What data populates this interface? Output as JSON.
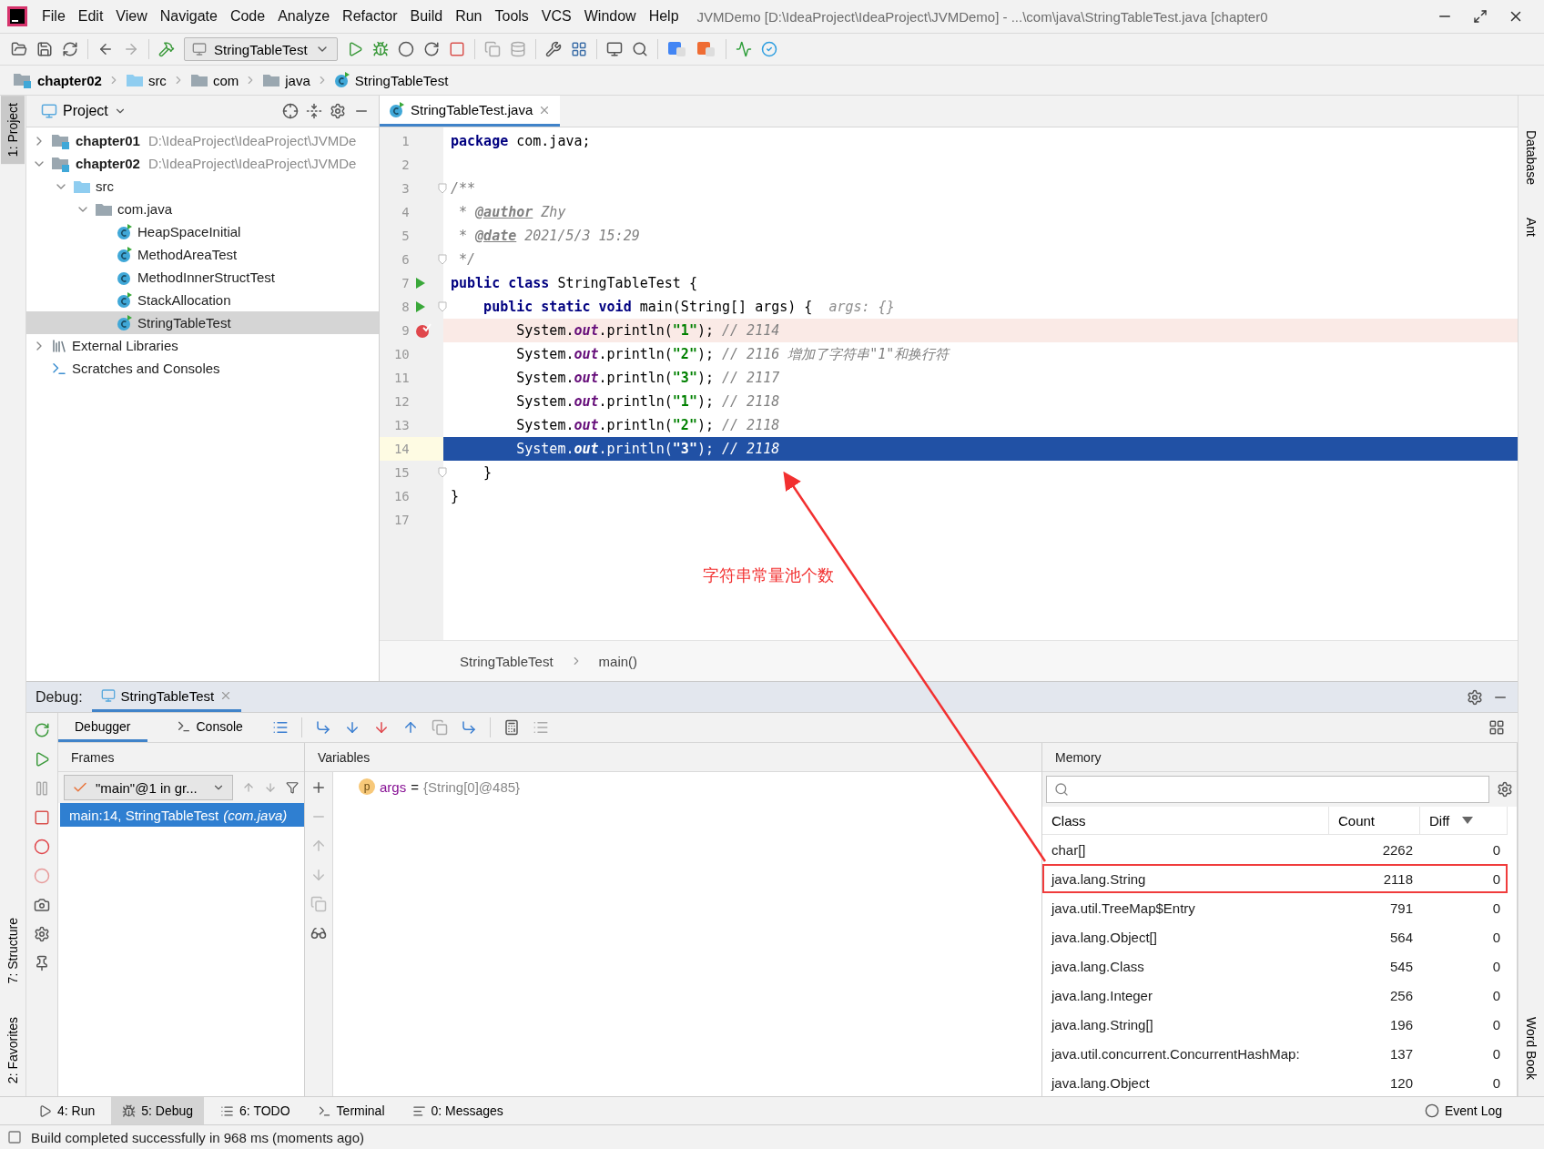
{
  "menu_bar": {
    "items": [
      "File",
      "Edit",
      "View",
      "Navigate",
      "Code",
      "Analyze",
      "Refactor",
      "Build",
      "Run",
      "Tools",
      "VCS",
      "Window",
      "Help"
    ],
    "title": "JVMDemo [D:\\IdeaProject\\IdeaProject\\JVMDemo] - ...\\com\\java\\StringTableTest.java [chapter0"
  },
  "toolbar": {
    "run_configuration": "StringTableTest"
  },
  "breadcrumb": [
    {
      "label": "chapter02",
      "kind": "module"
    },
    {
      "label": "src",
      "kind": "source"
    },
    {
      "label": "com",
      "kind": "package"
    },
    {
      "label": "java",
      "kind": "package"
    },
    {
      "label": "StringTableTest",
      "kind": "class"
    }
  ],
  "left_strip": {
    "top": [
      {
        "label": "1: Project",
        "selected": true
      }
    ],
    "bottom": [
      {
        "label": "7: Structure",
        "selected": false
      },
      {
        "label": "2: Favorites",
        "selected": false
      }
    ]
  },
  "right_strip": {
    "top": [
      "Database",
      "Ant"
    ],
    "bottom": [
      "Word Book"
    ]
  },
  "project": {
    "title": "Project",
    "tree": [
      {
        "label": "chapter01",
        "path": "D:\\IdeaProject\\IdeaProject\\JVMDe",
        "kind": "module",
        "expanded": false,
        "selected": false
      },
      {
        "label": "chapter02",
        "path": "D:\\IdeaProject\\IdeaProject\\JVMDe",
        "kind": "module",
        "expanded": true,
        "selected": false,
        "children": [
          {
            "label": "src",
            "kind": "source",
            "expanded": true,
            "selected": false,
            "children": [
              {
                "label": "com.java",
                "kind": "package",
                "expanded": true,
                "selected": false,
                "children": [
                  {
                    "label": "HeapSpaceInitial",
                    "kind": "class",
                    "runnable": true,
                    "selected": false
                  },
                  {
                    "label": "MethodAreaTest",
                    "kind": "class",
                    "runnable": true,
                    "selected": false
                  },
                  {
                    "label": "MethodInnerStructTest",
                    "kind": "class",
                    "runnable": false,
                    "selected": false
                  },
                  {
                    "label": "StackAllocation",
                    "kind": "class",
                    "runnable": true,
                    "selected": false
                  },
                  {
                    "label": "StringTableTest",
                    "kind": "class",
                    "runnable": true,
                    "selected": true
                  }
                ]
              }
            ]
          }
        ]
      },
      {
        "label": "External Libraries",
        "kind": "libraries",
        "expanded": false,
        "selected": false
      },
      {
        "label": "Scratches and Consoles",
        "kind": "scratches",
        "selected": false
      }
    ]
  },
  "editor": {
    "tab": "StringTableTest.java",
    "lines": [
      {
        "number": "1",
        "tokens": [
          {
            "kind": "keyword",
            "text": "package"
          },
          {
            "kind": "plain",
            "text": " com.java;"
          }
        ],
        "run_marker": false,
        "fold": false,
        "breakpoint": false,
        "selected": false
      },
      {
        "number": "2",
        "run_marker": false,
        "fold": false,
        "breakpoint": false,
        "selected": false
      },
      {
        "number": "3",
        "tokens": [
          {
            "kind": "comment",
            "text": "/**"
          }
        ],
        "run_marker": false,
        "fold": true,
        "breakpoint": false,
        "selected": false
      },
      {
        "number": "4",
        "tokens": [
          {
            "kind": "comment",
            "text": " * "
          },
          {
            "kind": "doctag",
            "text": "@author"
          },
          {
            "kind": "comment",
            "text": " Zhy"
          }
        ],
        "run_marker": false,
        "fold": false,
        "breakpoint": false,
        "selected": false
      },
      {
        "number": "5",
        "tokens": [
          {
            "kind": "comment",
            "text": " * "
          },
          {
            "kind": "doctag",
            "text": "@date"
          },
          {
            "kind": "comment",
            "text": " 2021/5/3 15:29"
          }
        ],
        "run_marker": false,
        "fold": false,
        "breakpoint": false,
        "selected": false
      },
      {
        "number": "6",
        "tokens": [
          {
            "kind": "comment",
            "text": " */"
          }
        ],
        "run_marker": false,
        "fold": true,
        "breakpoint": false,
        "selected": false
      },
      {
        "number": "7",
        "tokens": [
          {
            "kind": "keyword",
            "text": "public class"
          },
          {
            "kind": "plain",
            "text": " StringTableTest {"
          }
        ],
        "run_marker": true,
        "fold": false,
        "breakpoint": false,
        "selected": false
      },
      {
        "number": "8",
        "tokens": [
          {
            "kind": "keyword",
            "text": "    public static void"
          },
          {
            "kind": "plain",
            "text": " main(String[] args) {  "
          },
          {
            "kind": "hint",
            "text": "args: {}"
          }
        ],
        "run_marker": true,
        "fold": true,
        "breakpoint": false,
        "selected": false
      },
      {
        "number": "9",
        "tokens": [
          {
            "kind": "plain",
            "text": "        System."
          },
          {
            "kind": "field",
            "text": "out"
          },
          {
            "kind": "plain",
            "text": ".println("
          },
          {
            "kind": "string",
            "text": "\"1\""
          },
          {
            "kind": "plain",
            "text": "); "
          },
          {
            "kind": "comment",
            "text": "// 2114"
          }
        ],
        "run_marker": false,
        "fold": false,
        "breakpoint": true,
        "selected": false
      },
      {
        "number": "10",
        "tokens": [
          {
            "kind": "plain",
            "text": "        System."
          },
          {
            "kind": "field",
            "text": "out"
          },
          {
            "kind": "plain",
            "text": ".println("
          },
          {
            "kind": "string",
            "text": "\"2\""
          },
          {
            "kind": "plain",
            "text": "); "
          },
          {
            "kind": "comment",
            "text": "// 2116 增加了字符串\"1\"和换行符"
          }
        ],
        "run_marker": false,
        "fold": false,
        "breakpoint": false,
        "selected": false
      },
      {
        "number": "11",
        "tokens": [
          {
            "kind": "plain",
            "text": "        System."
          },
          {
            "kind": "field",
            "text": "out"
          },
          {
            "kind": "plain",
            "text": ".println("
          },
          {
            "kind": "string",
            "text": "\"3\""
          },
          {
            "kind": "plain",
            "text": "); "
          },
          {
            "kind": "comment",
            "text": "// 2117"
          }
        ],
        "run_marker": false,
        "fold": false,
        "breakpoint": false,
        "selected": false
      },
      {
        "number": "12",
        "tokens": [
          {
            "kind": "plain",
            "text": "        System."
          },
          {
            "kind": "field",
            "text": "out"
          },
          {
            "kind": "plain",
            "text": ".println("
          },
          {
            "kind": "string",
            "text": "\"1\""
          },
          {
            "kind": "plain",
            "text": "); "
          },
          {
            "kind": "comment",
            "text": "// 2118"
          }
        ],
        "run_marker": false,
        "fold": false,
        "breakpoint": false,
        "selected": false
      },
      {
        "number": "13",
        "tokens": [
          {
            "kind": "plain",
            "text": "        System."
          },
          {
            "kind": "field",
            "text": "out"
          },
          {
            "kind": "plain",
            "text": ".println("
          },
          {
            "kind": "string",
            "text": "\"2\""
          },
          {
            "kind": "plain",
            "text": "); "
          },
          {
            "kind": "comment",
            "text": "// 2118"
          }
        ],
        "run_marker": false,
        "fold": false,
        "breakpoint": false,
        "selected": false
      },
      {
        "number": "14",
        "tokens": [
          {
            "kind": "plain",
            "text": "        System."
          },
          {
            "kind": "field",
            "text": "out"
          },
          {
            "kind": "plain",
            "text": ".println("
          },
          {
            "kind": "string",
            "text": "\"3\""
          },
          {
            "kind": "plain",
            "text": "); "
          },
          {
            "kind": "comment",
            "text": "// 2118"
          }
        ],
        "run_marker": false,
        "fold": false,
        "breakpoint": false,
        "selected": true
      },
      {
        "number": "15",
        "tokens": [
          {
            "kind": "plain",
            "text": "    }"
          }
        ],
        "run_marker": false,
        "fold": true,
        "breakpoint": false,
        "selected": false
      },
      {
        "number": "16",
        "tokens": [
          {
            "kind": "plain",
            "text": "}"
          }
        ],
        "run_marker": false,
        "fold": false,
        "breakpoint": false,
        "selected": false
      },
      {
        "number": "17",
        "run_marker": false,
        "fold": false,
        "breakpoint": false,
        "selected": false
      }
    ],
    "breadcrumb": [
      "StringTableTest",
      "main()"
    ]
  },
  "annotation": {
    "text": "字符串常量池个数"
  },
  "debug": {
    "label": "Debug:",
    "session_tab": "StringTableTest",
    "tabs": [
      {
        "label": "Debugger",
        "kind": "debugger",
        "selected": true
      },
      {
        "label": "Console",
        "kind": "console",
        "selected": false
      }
    ],
    "frames": {
      "title": "Frames",
      "thread": "\"main\"@1 in gr...",
      "items": [
        {
          "text": "main:14, StringTableTest",
          "location": "(com.java)",
          "selected": true
        }
      ]
    },
    "variables": {
      "title": "Variables",
      "items": [
        {
          "badge": "p",
          "name": "args",
          "operator": "=",
          "value": "{String[0]@485}"
        }
      ]
    },
    "memory": {
      "title": "Memory",
      "columns": [
        {
          "label": "Class",
          "sorted": false
        },
        {
          "label": "Count",
          "sorted": false
        },
        {
          "label": "Diff",
          "sorted": true
        }
      ],
      "rows": [
        {
          "class": "char[]",
          "count": "2262",
          "diff": "0",
          "highlighted": false
        },
        {
          "class": "java.lang.String",
          "count": "2118",
          "diff": "0",
          "highlighted": true
        },
        {
          "class": "java.util.TreeMap$Entry",
          "count": "791",
          "diff": "0",
          "highlighted": false
        },
        {
          "class": "java.lang.Object[]",
          "count": "564",
          "diff": "0",
          "highlighted": false
        },
        {
          "class": "java.lang.Class",
          "count": "545",
          "diff": "0",
          "highlighted": false
        },
        {
          "class": "java.lang.Integer",
          "count": "256",
          "diff": "0",
          "highlighted": false
        },
        {
          "class": "java.lang.String[]",
          "count": "196",
          "diff": "0",
          "highlighted": false
        },
        {
          "class": "java.util.concurrent.ConcurrentHashMap:",
          "count": "137",
          "diff": "0",
          "highlighted": false
        },
        {
          "class": "java.lang.Object",
          "count": "120",
          "diff": "0",
          "highlighted": false
        }
      ]
    }
  },
  "tool_tabs": [
    {
      "label": "4: Run",
      "kind": "run",
      "selected": false
    },
    {
      "label": "5: Debug",
      "kind": "debug",
      "selected": true
    },
    {
      "label": "6: TODO",
      "kind": "todo",
      "selected": false
    },
    {
      "label": "Terminal",
      "kind": "terminal",
      "selected": false
    },
    {
      "label": "0: Messages",
      "kind": "messages",
      "selected": false
    }
  ],
  "event_log": "Event Log",
  "status": "Build completed successfully in 968 ms (moments ago)"
}
